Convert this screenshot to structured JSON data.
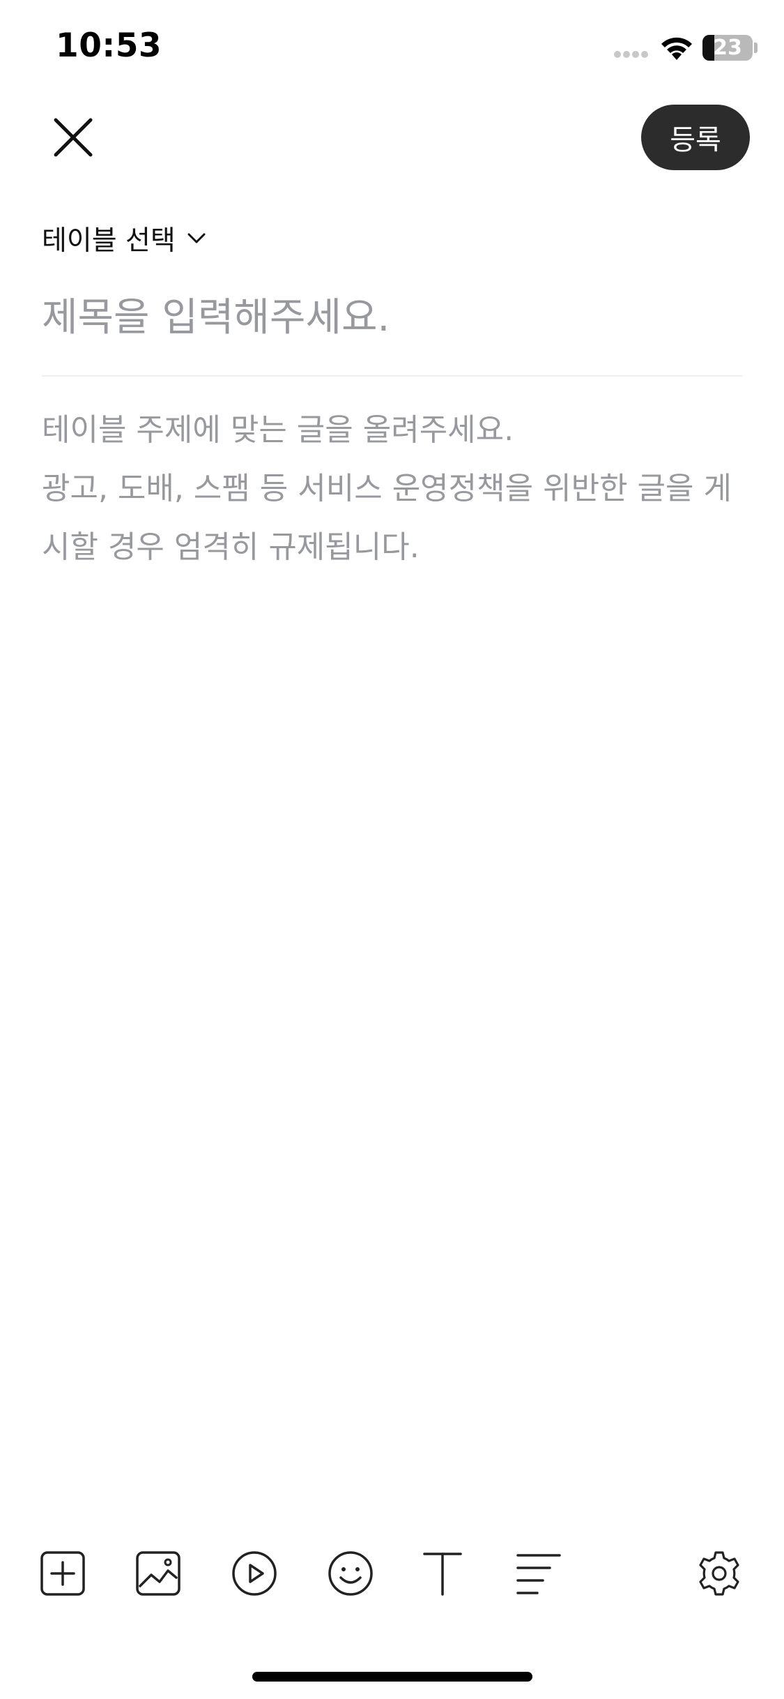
{
  "status_bar": {
    "time": "10:53",
    "battery_level": "23",
    "battery_fraction": 0.23
  },
  "header": {
    "close_icon": "close-icon",
    "register_label": "등록"
  },
  "editor": {
    "table_selector_label": "테이블 선택",
    "title_placeholder": "제목을 입력해주세요.",
    "body_placeholder": "테이블 주제에 맞는 글을 올려주세요.\n광고, 도배, 스팸 등 서비스 운영정책을 위반한 글을 게시할 경우 엄격히 규제됩니다."
  },
  "toolbar": {
    "icons": [
      "add-box-icon",
      "image-icon",
      "video-play-icon",
      "emoji-icon",
      "text-style-icon",
      "align-left-icon",
      "gear-icon"
    ]
  },
  "colors": {
    "button_bg": "#2c2c2c",
    "placeholder": "#98999e",
    "divider": "#eeeeee"
  }
}
